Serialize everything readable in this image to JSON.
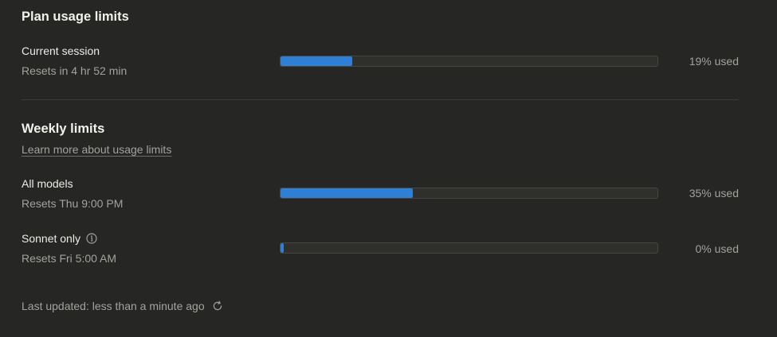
{
  "plan": {
    "title": "Plan usage limits",
    "session": {
      "label": "Current session",
      "resets": "Resets in 4 hr 52 min",
      "used_fraction": 0.19,
      "used_text": "19% used"
    }
  },
  "weekly": {
    "title": "Weekly limits",
    "learn_more": "Learn more about usage limits",
    "items": [
      {
        "label": "All models",
        "resets": "Resets Thu 9:00 PM",
        "used_fraction": 0.35,
        "used_text": "35% used"
      },
      {
        "label": "Sonnet only",
        "icon": "info-icon",
        "resets": "Resets Fri 5:00 AM",
        "used_fraction": 0.0,
        "used_text": "0% used"
      }
    ]
  },
  "footer": {
    "last_updated": "Last updated: less than a minute ago",
    "icon": "refresh-icon"
  },
  "colors": {
    "background": "#262624",
    "bar_fill": "#2f7fd6",
    "bar_track": "#2f2f2c"
  }
}
